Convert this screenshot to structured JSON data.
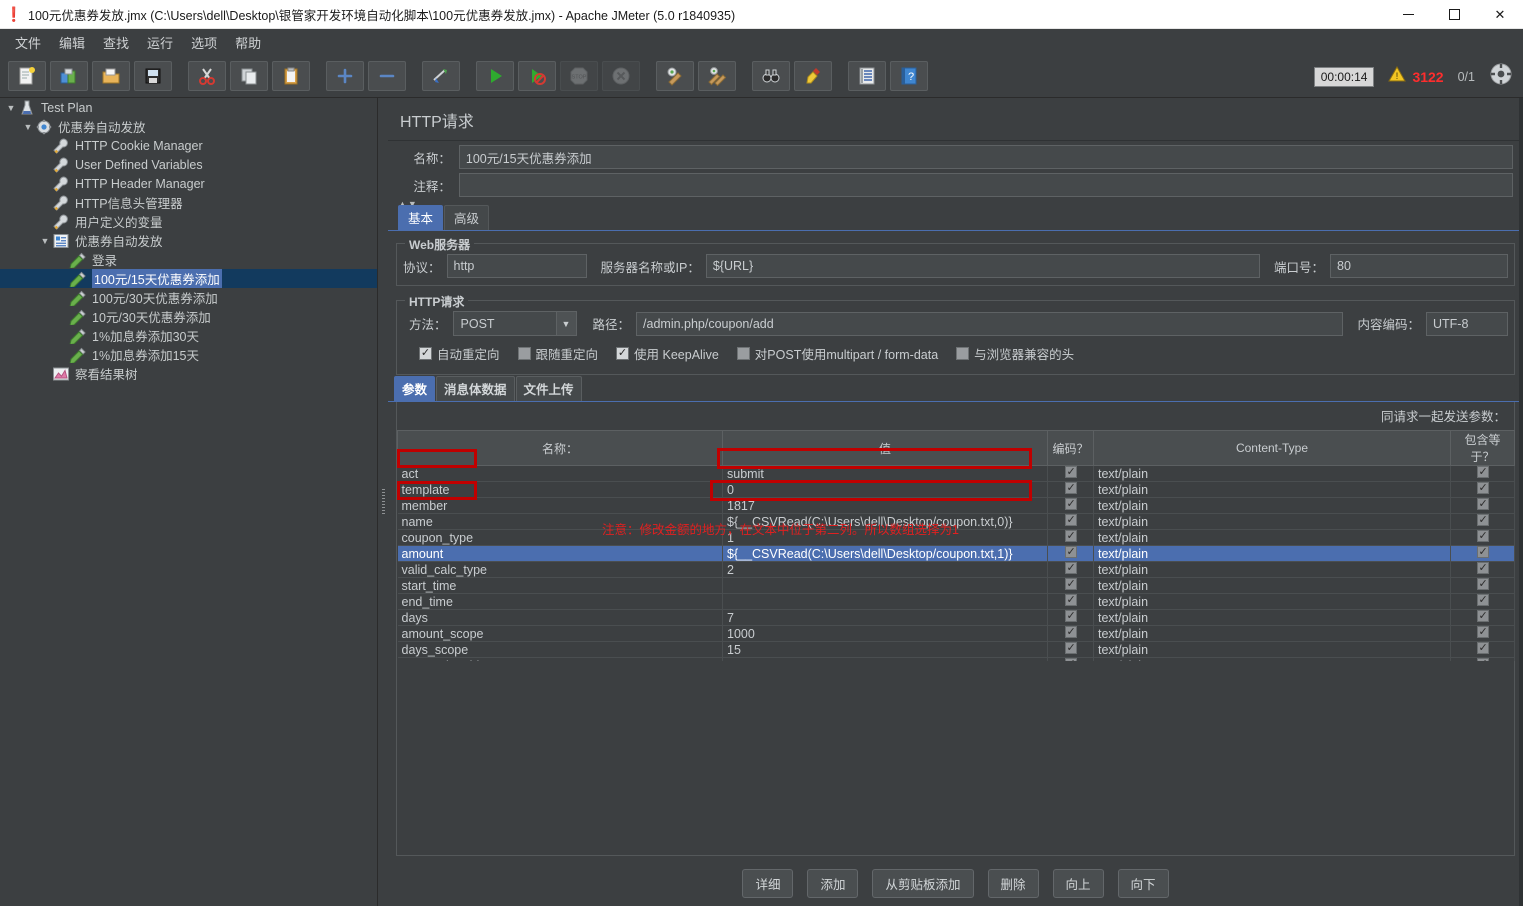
{
  "window": {
    "title": "100元优惠券发放.jmx (C:\\Users\\dell\\Desktop\\银管家开发环境自动化脚本\\100元优惠券发放.jmx) - Apache JMeter (5.0 r1840935)",
    "app_icon": "jmeter-flask-icon",
    "minimize_label": "–",
    "maximize_label": "□",
    "close_label": "✕"
  },
  "menu": {
    "items": [
      {
        "label": "文件",
        "name": "menu-file"
      },
      {
        "label": "编辑",
        "name": "menu-edit"
      },
      {
        "label": "查找",
        "name": "menu-search"
      },
      {
        "label": "运行",
        "name": "menu-run"
      },
      {
        "label": "选项",
        "name": "menu-options"
      },
      {
        "label": "帮助",
        "name": "menu-help"
      }
    ]
  },
  "toolbar": {
    "buttons": [
      {
        "icon": "new-document-icon",
        "name": "toolbar-new"
      },
      {
        "icon": "templates-icon",
        "name": "toolbar-templates"
      },
      {
        "icon": "open-folder-icon",
        "name": "toolbar-open"
      },
      {
        "icon": "save-floppy-icon",
        "name": "toolbar-save"
      },
      {
        "icon": "cut-scissors-icon",
        "name": "toolbar-cut"
      },
      {
        "icon": "copy-pages-icon",
        "name": "toolbar-copy"
      },
      {
        "icon": "paste-clipboard-icon",
        "name": "toolbar-paste"
      },
      {
        "icon": "plus-icon",
        "name": "toolbar-expand-all"
      },
      {
        "icon": "minus-icon",
        "name": "toolbar-collapse-all"
      },
      {
        "icon": "toggle-icon",
        "name": "toolbar-toggle"
      },
      {
        "icon": "run-play-icon",
        "name": "toolbar-start"
      },
      {
        "icon": "run-no-timers-icon",
        "name": "toolbar-start-no-pauses"
      },
      {
        "icon": "stop-icon",
        "name": "toolbar-stop"
      },
      {
        "icon": "shutdown-icon",
        "name": "toolbar-shutdown"
      },
      {
        "icon": "clear-icon",
        "name": "toolbar-clear"
      },
      {
        "icon": "clear-all-icon",
        "name": "toolbar-clear-all"
      },
      {
        "icon": "binoculars-search-icon",
        "name": "toolbar-search"
      },
      {
        "icon": "reset-search-icon",
        "name": "toolbar-reset-search"
      },
      {
        "icon": "function-helper-icon",
        "name": "toolbar-function-helper"
      },
      {
        "icon": "help-book-icon",
        "name": "toolbar-help"
      }
    ],
    "timer": "00:00:14",
    "warning_icon": "warning-triangle-icon",
    "warning_count": "3122",
    "thread_count": "0/1",
    "remote_icon": "remote-engines-icon",
    "warning_color": "#ff2d2d"
  },
  "tree": {
    "nodes": [
      {
        "label": "Test Plan",
        "depth": 0,
        "icon": "testplan-icon",
        "toggle": "▼",
        "selected": false
      },
      {
        "label": "优惠券自动发放",
        "depth": 1,
        "icon": "threadgroup-gear-icon",
        "toggle": "▼",
        "selected": false
      },
      {
        "label": "HTTP Cookie Manager",
        "depth": 2,
        "icon": "config-wrench-icon",
        "toggle": "",
        "selected": false
      },
      {
        "label": "User Defined Variables",
        "depth": 2,
        "icon": "config-wrench-icon",
        "toggle": "",
        "selected": false
      },
      {
        "label": "HTTP Header Manager",
        "depth": 2,
        "icon": "config-wrench-icon",
        "toggle": "",
        "selected": false
      },
      {
        "label": "HTTP信息头管理器",
        "depth": 2,
        "icon": "config-wrench-icon",
        "toggle": "",
        "selected": false
      },
      {
        "label": "用户定义的变量",
        "depth": 2,
        "icon": "config-wrench-icon",
        "toggle": "",
        "selected": false
      },
      {
        "label": "优惠券自动发放",
        "depth": 2,
        "icon": "controller-icon",
        "toggle": "▼",
        "selected": false
      },
      {
        "label": "登录",
        "depth": 3,
        "icon": "sampler-pen-icon",
        "toggle": "",
        "selected": false
      },
      {
        "label": "100元/15天优惠券添加",
        "depth": 3,
        "icon": "sampler-pen-icon",
        "toggle": "",
        "selected": true
      },
      {
        "label": "100元/30天优惠券添加",
        "depth": 3,
        "icon": "sampler-pen-icon",
        "toggle": "",
        "selected": false
      },
      {
        "label": "10元/30天优惠券添加",
        "depth": 3,
        "icon": "sampler-pen-icon",
        "toggle": "",
        "selected": false
      },
      {
        "label": "1%加息券添加30天",
        "depth": 3,
        "icon": "sampler-pen-icon",
        "toggle": "",
        "selected": false
      },
      {
        "label": "1%加息券添加15天",
        "depth": 3,
        "icon": "sampler-pen-icon",
        "toggle": "",
        "selected": false
      },
      {
        "label": "察看结果树",
        "depth": 2,
        "icon": "listener-chart-icon",
        "toggle": "",
        "selected": false
      }
    ]
  },
  "main": {
    "title": "HTTP请求",
    "name_label": "名称：",
    "name_value": "100元/15天优惠券添加",
    "comment_label": "注释：",
    "comment_value": "",
    "tabs": [
      {
        "label": "基本",
        "name": "tab-basic",
        "active": true
      },
      {
        "label": "高级",
        "name": "tab-advanced",
        "active": false
      }
    ],
    "webserver": {
      "group_title": "Web服务器",
      "protocol_label": "协议：",
      "protocol_value": "http",
      "server_label": "服务器名称或IP：",
      "server_value": "${URL}",
      "port_label": "端口号：",
      "port_value": "80"
    },
    "httprequest": {
      "group_title": "HTTP请求",
      "method_label": "方法：",
      "method_value": "POST",
      "path_label": "路径：",
      "path_value": "/admin.php/coupon/add",
      "encoding_label": "内容编码：",
      "encoding_value": "UTF-8"
    },
    "options": [
      {
        "label": "自动重定向",
        "checked": true,
        "name": "checkbox-auto-redirect"
      },
      {
        "label": "跟随重定向",
        "checked": false,
        "name": "checkbox-follow-redirect"
      },
      {
        "label": "使用 KeepAlive",
        "checked": true,
        "name": "checkbox-keepalive"
      },
      {
        "label": "对POST使用multipart / form-data",
        "checked": false,
        "name": "checkbox-multipart"
      },
      {
        "label": "与浏览器兼容的头",
        "checked": false,
        "name": "checkbox-browser-headers"
      }
    ],
    "param_tabs": [
      {
        "label": "参数",
        "name": "subtab-parameters",
        "active": true
      },
      {
        "label": "消息体数据",
        "name": "subtab-body-data",
        "active": false
      },
      {
        "label": "文件上传",
        "name": "subtab-file-upload",
        "active": false
      }
    ],
    "params": {
      "send_note": "同请求一起发送参数：",
      "columns": [
        "名称：",
        "值",
        "编码？",
        "Content-Type",
        "包含等于？"
      ],
      "rows": [
        {
          "name": "act",
          "value": "submit",
          "encode": true,
          "ctype": "text/plain",
          "include": true,
          "selected": false
        },
        {
          "name": "template",
          "value": "0",
          "encode": true,
          "ctype": "text/plain",
          "include": true,
          "selected": false
        },
        {
          "name": "member",
          "value": "1817",
          "encode": true,
          "ctype": "text/plain",
          "include": true,
          "selected": false
        },
        {
          "name": "name",
          "value": "${__CSVRead(C:\\Users\\dell\\Desktop/coupon.txt,0)}",
          "encode": true,
          "ctype": "text/plain",
          "include": true,
          "selected": false
        },
        {
          "name": "coupon_type",
          "value": "1",
          "encode": true,
          "ctype": "text/plain",
          "include": true,
          "selected": false
        },
        {
          "name": "amount",
          "value": "${__CSVRead(C:\\Users\\dell\\Desktop/coupon.txt,1)}",
          "encode": true,
          "ctype": "text/plain",
          "include": true,
          "selected": true
        },
        {
          "name": "valid_calc_type",
          "value": "2",
          "encode": true,
          "ctype": "text/plain",
          "include": true,
          "selected": false
        },
        {
          "name": "start_time",
          "value": "",
          "encode": true,
          "ctype": "text/plain",
          "include": true,
          "selected": false
        },
        {
          "name": "end_time",
          "value": "",
          "encode": true,
          "ctype": "text/plain",
          "include": true,
          "selected": false
        },
        {
          "name": "days",
          "value": "7",
          "encode": true,
          "ctype": "text/plain",
          "include": true,
          "selected": false
        },
        {
          "name": "amount_scope",
          "value": "1000",
          "encode": true,
          "ctype": "text/plain",
          "include": true,
          "selected": false
        },
        {
          "name": "days_scope",
          "value": "15",
          "encode": true,
          "ctype": "text/plain",
          "include": true,
          "selected": false
        },
        {
          "name": "transaction_id",
          "value": "",
          "encode": true,
          "ctype": "text/plain",
          "include": true,
          "selected": false
        }
      ],
      "annotation": "注意：修改金额的地方，在文本中位于第二列。所以数组选择为1",
      "annotation_color": "#e02020"
    },
    "buttons": [
      {
        "label": "详细",
        "name": "detail-button"
      },
      {
        "label": "添加",
        "name": "add-button"
      },
      {
        "label": "从剪贴板添加",
        "name": "add-from-clipboard-button"
      },
      {
        "label": "删除",
        "name": "delete-button"
      },
      {
        "label": "向上",
        "name": "move-up-button"
      },
      {
        "label": "向下",
        "name": "move-down-button"
      }
    ]
  }
}
